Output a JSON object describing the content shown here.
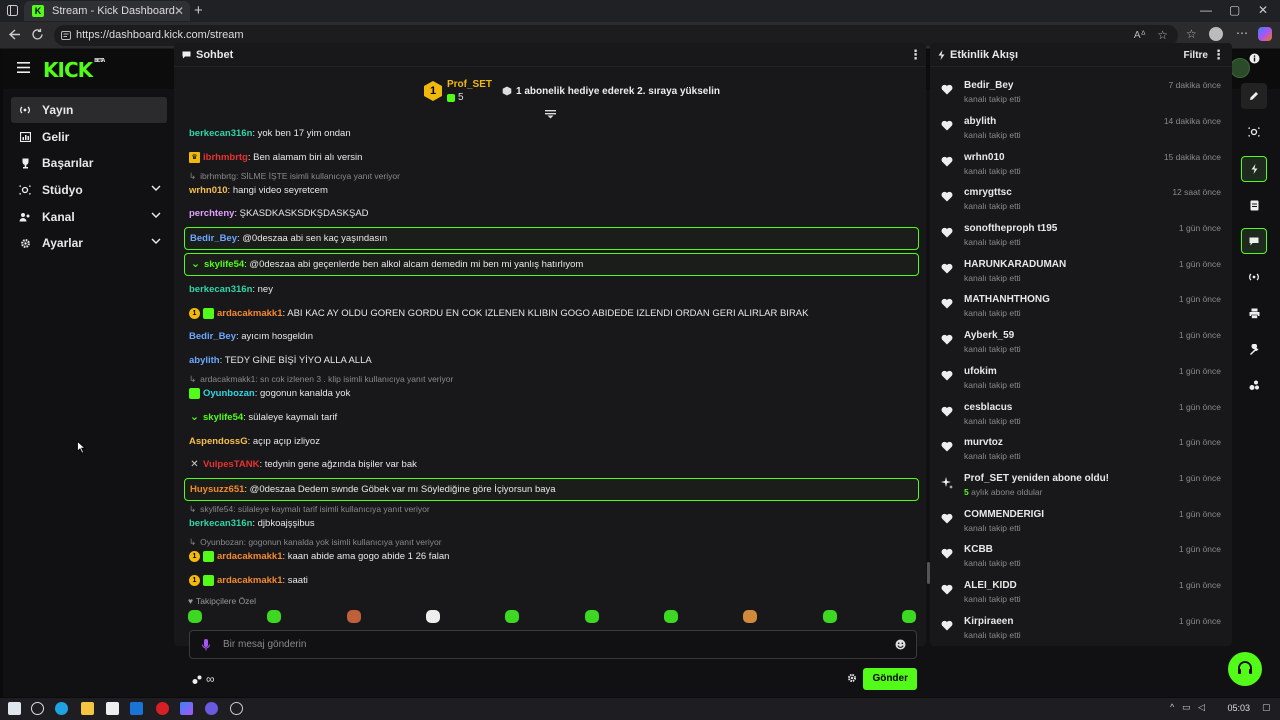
{
  "browser": {
    "tab_title": "Stream - Kick Dashboard",
    "url": "https://dashboard.kick.com/stream"
  },
  "app": {
    "logo": "KICK",
    "logo_badge": "BETA"
  },
  "sidebar": {
    "items": [
      {
        "label": "Yayın",
        "icon": "broadcast-icon"
      },
      {
        "label": "Gelir",
        "icon": "revenue-icon"
      },
      {
        "label": "Başarılar",
        "icon": "trophy-icon"
      },
      {
        "label": "Stüdyo",
        "icon": "studio-icon"
      },
      {
        "label": "Kanal",
        "icon": "channel-icon"
      },
      {
        "label": "Ayarlar",
        "icon": "gear-icon"
      }
    ]
  },
  "chat": {
    "title": "Sohbet",
    "pinned": {
      "rank": "1",
      "name": "Prof_SET",
      "count": "5",
      "goal": "1 abonelik hediye ederek 2. sıraya yükselin"
    },
    "messages": [
      {
        "user": "berkecan316n",
        "text": ": yok ben 17 yim ondan",
        "color": "#2fd6a5"
      },
      {
        "user": "ibrhmbrtg",
        "text": ": Ben alamam biri alı versin",
        "color": "#e8322f"
      },
      {
        "reply": "ibrhmbrtg: SİLME İŞTE isimli kullanıcıya yanıt veriyor",
        "user": "wrhn010",
        "text": ": hangi video seyretcem",
        "color": "#f5c04a"
      },
      {
        "user": "perchteny",
        "text": ": ŞKASDKASKSDKŞDASKŞAD",
        "color": "#e0a0ff"
      },
      {
        "user": "Bedir_Bey",
        "text": ": @0deszaa abi sen kaç yaşındasın",
        "color": "#6aa8ff"
      },
      {
        "user": "skylife54",
        "text": ": @0deszaa abi geçenlerde ben alkol alcam demedin mi ben mi yanlış hatırlıyom",
        "color": "#53fc18"
      },
      {
        "user": "berkecan316n",
        "text": ": ney",
        "color": "#2fd6a5"
      },
      {
        "user": "ardacakmakk1",
        "text": ": ABI KAC AY OLDU GOREN GORDU EN COK IZLENEN KLIBIN GOGO ABIDEDE IZLENDI ORDAN GERI ALIRLAR BIRAK",
        "color": "#f58a2a"
      },
      {
        "user": "Bedir_Bey",
        "text": ": ayıcım hosgeldın",
        "color": "#6aa8ff"
      },
      {
        "user": "abylith",
        "text": ": TEDY GİNE BİŞİ YİYO ALLA ALLA",
        "color": "#6aa8ff"
      },
      {
        "reply": "ardacakmakk1: sn cok izlenen 3 . klip isimli kullanıcıya yanıt veriyor",
        "user": "Oyunbozan",
        "text": ": gogonun kanalda yok",
        "color": "#2fd6e0"
      },
      {
        "user": "skylife54",
        "text": ": sülaleye kaymalı tarif",
        "color": "#53fc18"
      },
      {
        "user": "AspendossG",
        "text": ": açıp açıp izliyoz",
        "color": "#f5c04a"
      },
      {
        "user": "VulpesTANK",
        "text": ": tedynin gene ağzında bişiler var bak",
        "color": "#e8322f"
      },
      {
        "user": "Huysuzz651",
        "text": ": @0deszaa Dedem swnde Göbek var mı Söylediğine göre İçiyorsun baya",
        "color": "#f58a2a"
      },
      {
        "reply": "skylife54: sülaleye kaymalı tarif isimli kullanıcıya yanıt veriyor",
        "user": "berkecan316n",
        "text": ": djbkoajşşibus",
        "color": "#2fd6a5"
      },
      {
        "reply": "Oyunbozan: gogonun kanalda yok isimli kullanıcıya yanıt veriyor",
        "user": "ardacakmakk1",
        "text": ": kaan abide ama gogo abide 1 26 falan",
        "color": "#f58a2a"
      },
      {
        "user": "ardacakmakk1",
        "text": ": saati",
        "color": "#f58a2a"
      }
    ],
    "followers_label": "Takipçilere Özel",
    "input_placeholder": "Bir mesaj gönderin",
    "send_label": "Gönder",
    "infinity": "∞"
  },
  "activity": {
    "title": "Etkinlik Akışı",
    "filter_label": "Filtre",
    "items": [
      {
        "name": "Bedir_Bey",
        "sub": "kanalı takip etti",
        "time": "7 dakika önce"
      },
      {
        "name": "abylith",
        "sub": "kanalı takip etti",
        "time": "14 dakika önce"
      },
      {
        "name": "wrhn010",
        "sub": "kanalı takip etti",
        "time": "15 dakika önce"
      },
      {
        "name": "cmrygttsc",
        "sub": "kanalı takip etti",
        "time": "12 saat önce"
      },
      {
        "name": "sonoftheproph t195",
        "sub": "kanalı takip etti",
        "time": "1 gün önce"
      },
      {
        "name": "HARUNKARADUMAN",
        "sub": "kanalı takip etti",
        "time": "1 gün önce"
      },
      {
        "name": "MATHANHTHONG",
        "sub": "kanalı takip etti",
        "time": "1 gün önce"
      },
      {
        "name": "Ayberk_59",
        "sub": "kanalı takip etti",
        "time": "1 gün önce"
      },
      {
        "name": "ufokim",
        "sub": "kanalı takip etti",
        "time": "1 gün önce"
      },
      {
        "name": "cesblacus",
        "sub": "kanalı takip etti",
        "time": "1 gün önce"
      },
      {
        "name": "murvtoz",
        "sub": "kanalı takip etti",
        "time": "1 gün önce"
      },
      {
        "name": "Prof_SET yeniden abone oldu!",
        "sub_hl": "5",
        "sub": " aylık abone oldular",
        "time": "1 gün önce"
      },
      {
        "name": "COMMENDERIGI",
        "sub": "kanalı takip etti",
        "time": "1 gün önce"
      },
      {
        "name": "KCBB",
        "sub": "kanalı takip etti",
        "time": "1 gün önce"
      },
      {
        "name": "ALEI_KIDD",
        "sub": "kanalı takip etti",
        "time": "1 gün önce"
      },
      {
        "name": "Kirpiraeen",
        "sub": "kanalı takip etti",
        "time": "1 gün önce"
      }
    ]
  },
  "taskbar": {
    "time": "05:03"
  },
  "colors": {
    "accent": "#53fc18",
    "panel": "#18181b",
    "background": "#111113"
  }
}
